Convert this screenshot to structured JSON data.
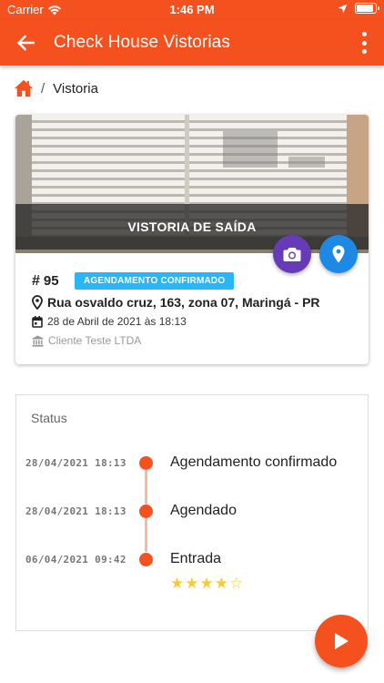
{
  "status_bar": {
    "carrier": "Carrier",
    "time": "1:46 PM"
  },
  "app_bar": {
    "title": "Check House Vistorias"
  },
  "breadcrumb": {
    "current": "Vistoria",
    "separator": "/"
  },
  "card": {
    "photo_caption": "VISTORIA DE SAÍDA",
    "id_hash": "#",
    "id_number": "95",
    "badge": "AGENDAMENTO CONFIRMADO",
    "address": "Rua osvaldo cruz, 163, zona 07, Maringá - PR",
    "date": "28 de Abril de 2021 às 18:13",
    "client": "Cliente Teste LTDA"
  },
  "status": {
    "heading": "Status",
    "timeline": [
      {
        "date": "28/04/2021 18:13",
        "label": "Agendamento confirmado"
      },
      {
        "date": "28/04/2021 18:13",
        "label": "Agendado"
      },
      {
        "date": "06/04/2021 09:42",
        "label": "Entrada"
      }
    ],
    "rating": {
      "value": 4,
      "max": 5
    }
  },
  "colors": {
    "primary": "#f4511e",
    "badge": "#29b6f6",
    "camera_fab": "#673ab7",
    "location_fab": "#1e88e5",
    "star": "#f9c93a"
  },
  "icons": [
    "back-arrow-icon",
    "more-vert-icon",
    "home-icon",
    "camera-icon",
    "location-pin-icon",
    "calendar-icon",
    "bank-icon",
    "star-icon",
    "play-icon",
    "wifi-icon",
    "battery-icon",
    "navigation-arrow-icon"
  ]
}
